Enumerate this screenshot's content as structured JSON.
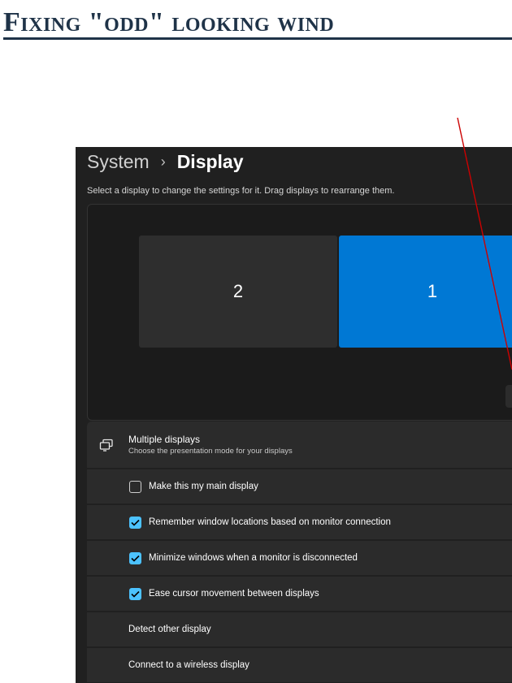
{
  "slide": {
    "title": "Fixing \"odd\" looking wind"
  },
  "settings": {
    "breadcrumb_parent": "System",
    "breadcrumb_separator": "›",
    "breadcrumb_current": "Display",
    "subtitle": "Select a display to change the settings for it. Drag displays to rearrange them.",
    "monitors": [
      {
        "label": "2",
        "selected": false
      },
      {
        "label": "1",
        "selected": true
      }
    ],
    "multiple_displays": {
      "title": "Multiple displays",
      "description": "Choose the presentation mode for your displays",
      "icon": "multiple-displays-icon"
    },
    "options": [
      {
        "label": "Make this my main display",
        "checked": false
      },
      {
        "label": "Remember window locations based on monitor connection",
        "checked": true
      },
      {
        "label": "Minimize windows when a monitor is disconnected",
        "checked": true
      },
      {
        "label": "Ease cursor movement between displays",
        "checked": true
      }
    ],
    "actions": [
      {
        "label": "Detect other display"
      },
      {
        "label": "Connect to a wireless display"
      }
    ]
  },
  "colors": {
    "accent": "#0078d4",
    "checkbox_accent": "#4cc2ff",
    "annotation_arrow": "#cc0000",
    "title": "#1f3348"
  }
}
